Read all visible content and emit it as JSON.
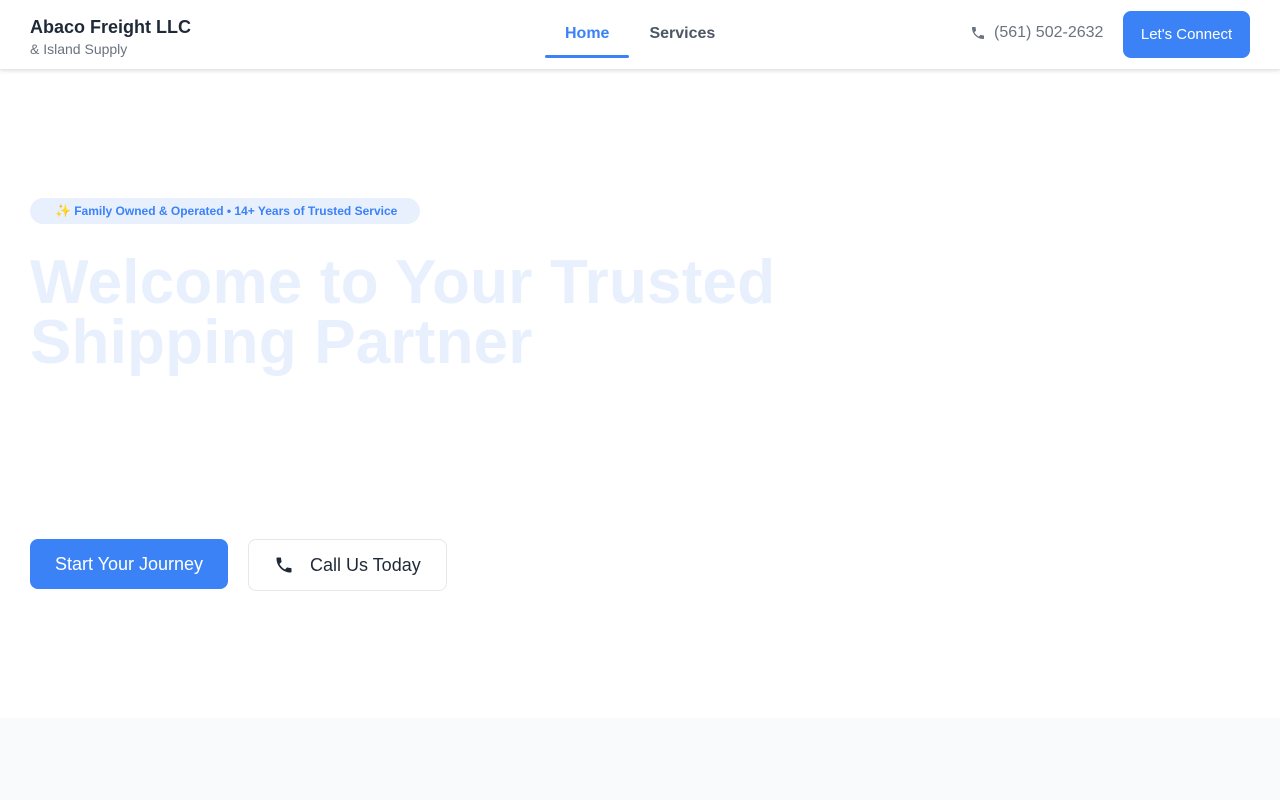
{
  "brand": {
    "name": "Abaco Freight LLC",
    "subtitle": "& Island Supply"
  },
  "nav": {
    "items": [
      {
        "label": "Home",
        "active": true
      },
      {
        "label": "Services",
        "active": false
      }
    ]
  },
  "header": {
    "phone": "(561) 502-2632",
    "phone_icon": "phone-icon",
    "cta_label": "Let's Connect"
  },
  "hero": {
    "badge_icon": "✨",
    "badge_text": "Family Owned & Operated • 14+ Years of Trusted Service",
    "title": "Welcome to Your Trusted Shipping Partner",
    "primary_button": "Start Your Journey",
    "secondary_button": "Call Us Today",
    "secondary_icon": "phone-icon"
  },
  "colors": {
    "accent": "#3b82f6",
    "title_faded": "#e8f0fe",
    "badge_bg": "#e8f0fe",
    "muted_text": "#6b7280"
  }
}
